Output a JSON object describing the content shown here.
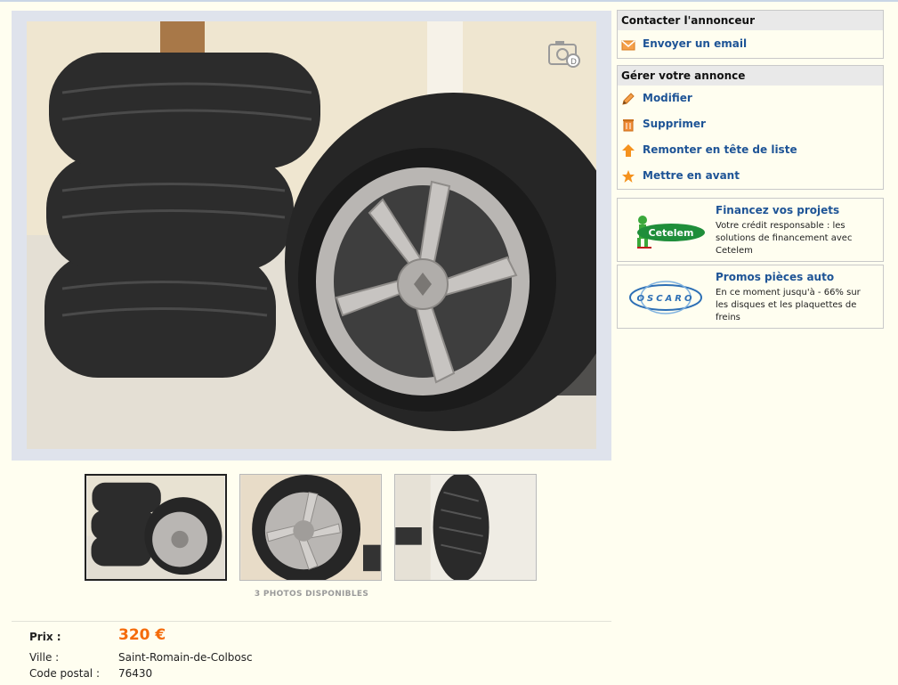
{
  "gallery": {
    "photos_count_label": "3 PHOTOS DISPONIBLES",
    "thumbnails": [
      "thumb-tires-stack",
      "thumb-rim-closeup",
      "thumb-tread"
    ]
  },
  "details": {
    "price_label": "Prix :",
    "price_value": "320 €",
    "city_label": "Ville :",
    "city_value": "Saint-Romain-de-Colbosc",
    "postal_label": "Code postal :",
    "postal_value": "76430"
  },
  "contact": {
    "header": "Contacter l'annonceur",
    "email_label": "Envoyer un email"
  },
  "manage": {
    "header": "Gérer votre annonce",
    "items": [
      {
        "label": "Modifier",
        "icon": "pencil-icon"
      },
      {
        "label": "Supprimer",
        "icon": "trash-icon"
      },
      {
        "label": "Remonter en tête de liste",
        "icon": "arrow-up-icon"
      },
      {
        "label": "Mettre en avant",
        "icon": "star-icon"
      }
    ]
  },
  "promos": [
    {
      "title": "Financez vos projets",
      "text": "Votre crédit responsable : les solutions de financement avec Cetelem",
      "logo_text": "Cetelem"
    },
    {
      "title": "Promos pièces auto",
      "text": "En ce moment jusqu'à - 66% sur les disques et les plaquettes de freins",
      "logo_text": "OSCARO"
    }
  ],
  "colors": {
    "background": "#fffef0",
    "link": "#1e5496",
    "price": "#f56b0a"
  }
}
